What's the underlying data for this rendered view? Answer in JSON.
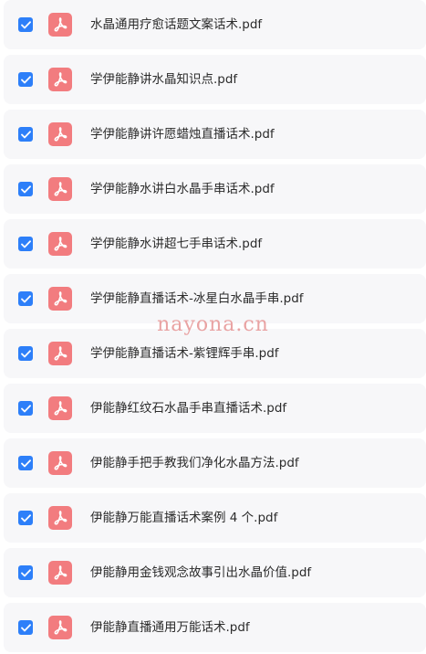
{
  "colors": {
    "accent": "#2d7ff9",
    "pdf_icon": "#f27c7f",
    "row_bg": "#f7f7f9"
  },
  "icons": {
    "checkbox": "check-icon",
    "file": "pdf-file-icon"
  },
  "watermark": "nayona.cn",
  "files": [
    {
      "name": "水晶通用疗愈话题文案话术.pdf",
      "checked": true
    },
    {
      "name": "学伊能静讲水晶知识点.pdf",
      "checked": true
    },
    {
      "name": "学伊能静讲许愿蜡烛直播话术.pdf",
      "checked": true
    },
    {
      "name": "学伊能静水讲白水晶手串话术.pdf",
      "checked": true
    },
    {
      "name": "学伊能静水讲超七手串话术.pdf",
      "checked": true
    },
    {
      "name": "学伊能静直播话术-冰星白水晶手串.pdf",
      "checked": true
    },
    {
      "name": "学伊能静直播话术-紫锂辉手串.pdf",
      "checked": true
    },
    {
      "name": "伊能静红纹石水晶手串直播话术.pdf",
      "checked": true
    },
    {
      "name": "伊能静手把手教我们净化水晶方法.pdf",
      "checked": true
    },
    {
      "name": "伊能静万能直播话术案例 4 个.pdf",
      "checked": true
    },
    {
      "name": "伊能静用金钱观念故事引出水晶价值.pdf",
      "checked": true
    },
    {
      "name": "伊能静直播通用万能话术.pdf",
      "checked": true
    }
  ]
}
